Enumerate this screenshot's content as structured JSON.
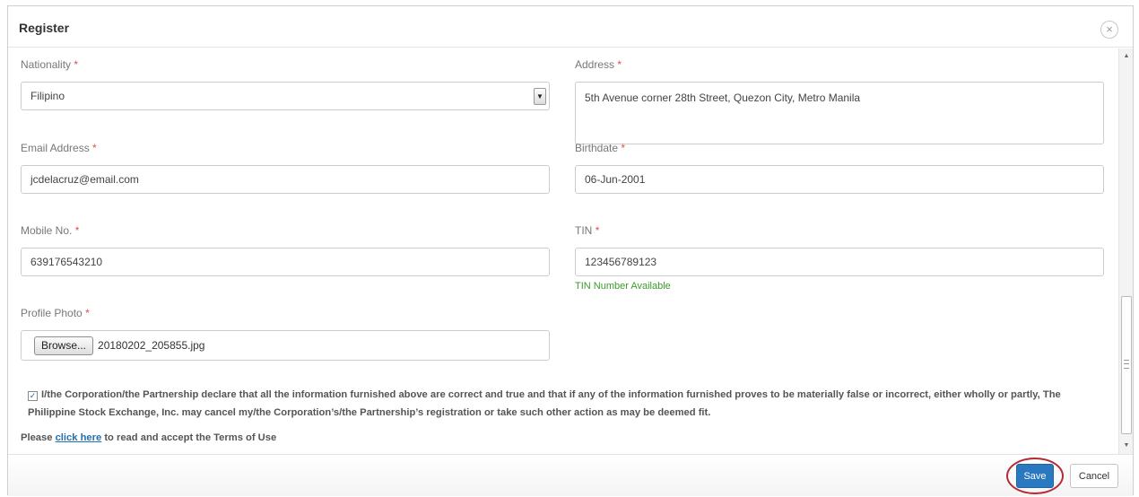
{
  "dialog": {
    "title": "Register",
    "close_icon": "×"
  },
  "form": {
    "nationality": {
      "label": "Nationality",
      "required": "*",
      "value": "Filipino"
    },
    "address": {
      "label": "Address",
      "required": "*",
      "value": "5th Avenue corner 28th Street, Quezon City, Metro Manila"
    },
    "email": {
      "label": "Email Address",
      "required": "*",
      "value": "jcdelacruz@email.com"
    },
    "birthdate": {
      "label": "Birthdate",
      "required": "*",
      "value": "06-Jun-2001"
    },
    "mobile": {
      "label": "Mobile No.",
      "required": "*",
      "value": "639176543210"
    },
    "tin": {
      "label": "TIN",
      "required": "*",
      "value": "123456789123",
      "status": "TIN Number Available"
    },
    "photo": {
      "label": "Profile Photo",
      "required": "*",
      "browse_label": "Browse...",
      "file_name": "20180202_205855.jpg"
    }
  },
  "declaration": {
    "checked": true,
    "check_mark": "✓",
    "text": "I/the Corporation/the Partnership declare that all the information furnished above are correct and true and that if any of the information furnished proves to be materially false or incorrect, either wholly or partly, The Philippine Stock Exchange, Inc. may cancel my/the Corporation’s/the Partnership’s registration or take such other action as may be deemed fit."
  },
  "terms": {
    "prefix": "Please",
    "link": "click here",
    "suffix": "to read and accept the Terms of Use"
  },
  "footer": {
    "save_label": "Save",
    "cancel_label": "Cancel"
  },
  "icons": {
    "dropdown": "chevron-down-icon",
    "close": "close-icon",
    "scroll_up": "▲",
    "scroll_down": "▼"
  },
  "colors": {
    "accent": "#2a78bf",
    "required": "#d9534f",
    "success": "#3c9a2c",
    "highlight_ring": "#b52a32"
  }
}
